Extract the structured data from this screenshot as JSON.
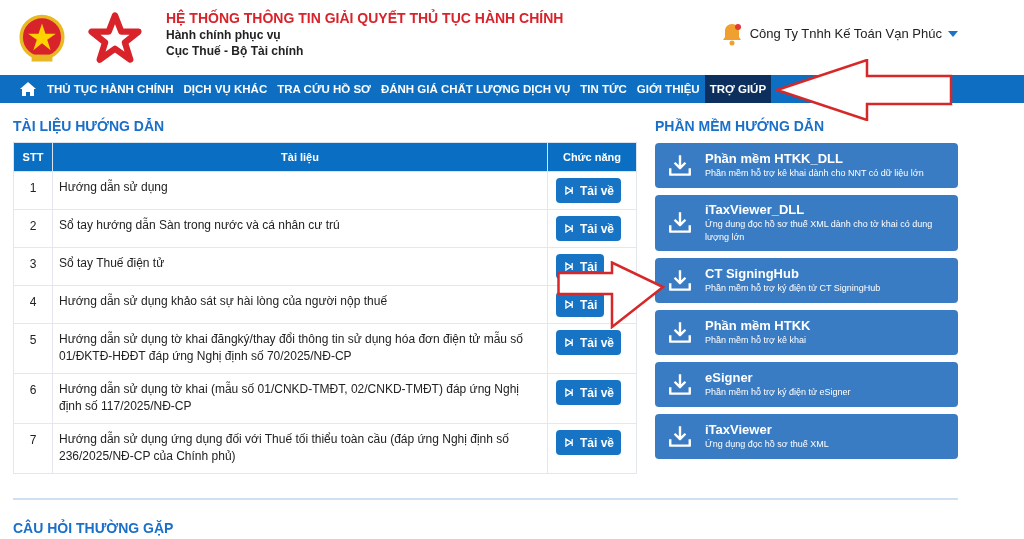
{
  "header": {
    "title": "HỆ THỐNG THÔNG TIN GIẢI QUYẾT THỦ TỤC HÀNH CHÍNH",
    "subtitle_1": "Hành chính phục vụ",
    "subtitle_2": "Cục Thuế - Bộ Tài chính",
    "user": "Công Ty Tnhh Kế Toán Vạn Phúc"
  },
  "nav": [
    {
      "label": "THỦ TỤC HÀNH CHÍNH",
      "selected": false
    },
    {
      "label": "DỊCH VỤ KHÁC",
      "selected": false
    },
    {
      "label": "TRA CỨU HỒ SƠ",
      "selected": false
    },
    {
      "label": "ĐÁNH GIÁ CHẤT LƯỢNG DỊCH VỤ",
      "selected": false
    },
    {
      "label": "TIN TỨC",
      "selected": false
    },
    {
      "label": "GIỚI THIỆU",
      "selected": false
    },
    {
      "label": "TRỢ GIÚP",
      "selected": true
    }
  ],
  "documents": {
    "title": "TÀI LIỆU HƯỚNG DẪN",
    "columns": [
      "STT",
      "Tài liệu",
      "Chức năng"
    ],
    "rows": [
      {
        "stt": "1",
        "name": "Hướng dẫn sử dụng",
        "action": "Tải về"
      },
      {
        "stt": "2",
        "name": "Sổ tay hướng dẫn Sàn trong nước và cá nhân cư trú",
        "action": "Tải về"
      },
      {
        "stt": "3",
        "name": "Sổ tay Thuế điện tử",
        "action": "Tải"
      },
      {
        "stt": "4",
        "name": "Hướng dẫn sử dụng khảo sát sự hài lòng của người nộp thuế",
        "action": "Tải"
      },
      {
        "stt": "5",
        "name": "Hướng dẫn sử dụng tờ khai đăngký/thay đổi thông tin sử dụng hóa đơn điện tử mẫu số 01/ĐKTĐ-HĐĐT đáp ứng Nghị định số 70/2025/NĐ-CP",
        "action": "Tải về"
      },
      {
        "stt": "6",
        "name": "Hướng dẫn sử dụng tờ khai (mẫu số 01/CNKD-TMĐT, 02/CNKD-TMĐT) đáp ứng Nghị định số 117/2025/NĐ-CP",
        "action": "Tải về"
      },
      {
        "stt": "7",
        "name": "Hướng dẫn sử dụng ứng dụng đối với Thuế tối thiểu toàn cầu (đáp ứng Nghị định số 236/2025/NĐ-CP của Chính phủ)",
        "action": "Tải về"
      }
    ]
  },
  "software": {
    "title": "PHẦN MỀM HƯỚNG DẪN",
    "items": [
      {
        "name": "Phần mềm HTKK_DLL",
        "description": "Phần mềm hỗ trợ kê khai dành cho NNT có dữ liệu lớn"
      },
      {
        "name": "iTaxViewer_DLL",
        "description": "Ứng dung đọc hồ sơ thuế XML dành cho tờ khai có dung lượng lớn"
      },
      {
        "name": "CT SigningHub",
        "description": "Phần mềm hỗ trợ ký điện tử CT SigningHub"
      },
      {
        "name": "Phần mềm HTKK",
        "description": "Phần mềm hỗ trợ kê khai"
      },
      {
        "name": "eSigner",
        "description": "Phần mềm hỗ trợ ký điện tử eSigner"
      },
      {
        "name": "iTaxViewer",
        "description": "Ứng dụng đọc hồ sơ thuế XML"
      }
    ]
  },
  "faq": {
    "title": "CÂU HỎI THƯỜNG GẶP"
  },
  "annotations": [
    {
      "kind": "left-arrow"
    },
    {
      "kind": "right-arrow"
    }
  ]
}
